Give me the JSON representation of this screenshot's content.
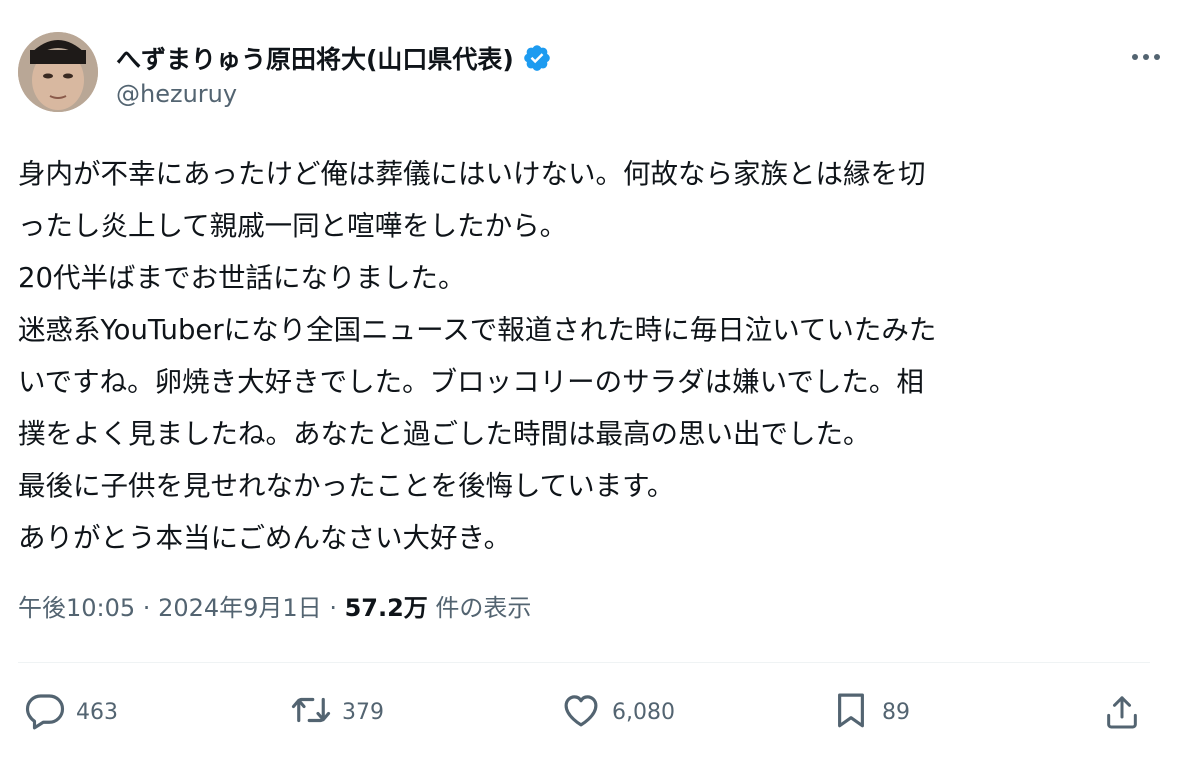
{
  "author": {
    "display_name": "へずまりゅう原田将大(山口県代表)",
    "handle": "@hezuruy"
  },
  "tweet": {
    "lines": [
      "身内が不幸にあったけど俺は葬儀にはいけない。何故なら家族とは縁を切",
      "ったし炎上して親戚一同と喧嘩をしたから。",
      "20代半ばまでお世話になりました。",
      "迷惑系YouTuberになり全国ニュースで報道された時に毎日泣いていたみた",
      "いですね。卵焼き大好きでした。ブロッコリーのサラダは嫌いでした。相",
      "撲をよく見ましたね。あなたと過ごした時間は最高の思い出でした。",
      "最後に子供を見せれなかったことを後悔しています。",
      "ありがとう本当にごめんなさい大好き。"
    ]
  },
  "meta": {
    "time": "午後10:05",
    "sep1": " · ",
    "date": "2024年9月1日",
    "sep2": " · ",
    "views_count": "57.2万",
    "views_label": " 件の表示"
  },
  "actions": {
    "replies": "463",
    "reposts": "379",
    "likes": "6,080",
    "bookmarks": "89"
  },
  "icons": {
    "verified": "verified-badge-icon",
    "more": "more-icon",
    "reply": "reply-icon",
    "repost": "repost-icon",
    "like": "heart-icon",
    "bookmark": "bookmark-icon",
    "share": "share-icon"
  },
  "colors": {
    "text": "#0f1419",
    "secondary": "#536471",
    "verified": "#1d9bf0",
    "divider": "#eff3f4"
  }
}
